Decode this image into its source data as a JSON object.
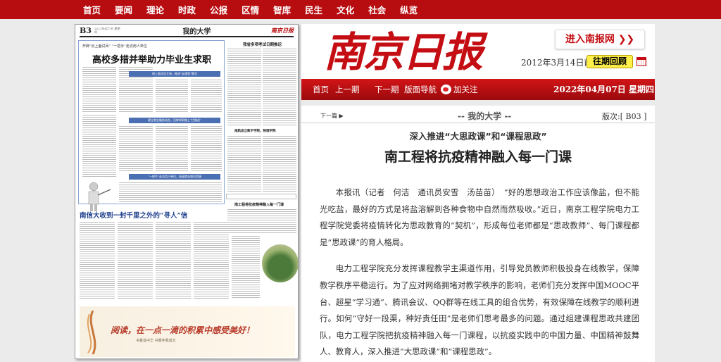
{
  "topnav": [
    "首页",
    "要闻",
    "理论",
    "时政",
    "公报",
    "区情",
    "智库",
    "民生",
    "文化",
    "社会",
    "纵览"
  ],
  "thumb": {
    "page": "B3",
    "date": "2022年4月7日 星期四",
    "section": "我的大学",
    "logo": "南京日报",
    "kicker": "开辟“云上面试间” “一把手”走访用人单位",
    "headline": "高校多措并举助力毕业生求职",
    "bar1": "线上面试没主场，推进“云课堂”教学",
    "bar2": "建立就业服务站台，扫除求职路上“拦路虎”",
    "bar3": "“一把手”走访用人单位，拓展就业岗位资源",
    "right_title1": "我省多项考试日期推迟",
    "right_title2": "南航成立数字学院，物理学院",
    "right_title3": "南工程将抗疫精神融入每一门课",
    "headline2": "南信大收到一封千里之外的“寻人”信",
    "ad_main": "阅读，在一点一滴的积累中感受美好！",
    "ad_sub": "书香溢中华 书香伴我成长"
  },
  "header": {
    "logo": "南京日报",
    "enter_label": "进入南报网 ❯❯",
    "old_date": "2012年3月14日前",
    "review_label": "往期回顾"
  },
  "rednav": {
    "home": "首页",
    "prev": "上一期",
    "next": "下一期",
    "guide": "版面导航",
    "follow": "加关注",
    "date": "2022年04月07日 星期四"
  },
  "article": {
    "next_article": "下一篇",
    "section": "-- 我的大学 --",
    "edition": "版次:[ B03 ]",
    "subtitle": "深入推进“大思政课”和“课程思政”",
    "title": "南工程将抗疫精神融入每一门课",
    "paragraphs": [
      "本报讯（记者　何洁　通讯员安雪　汤苗苗）　“好的思想政治工作应该像盐，但不能光吃盐，最好的方式是将盐溶解到各种食物中自然而然吸收。”近日，南京工程学院电力工程学院党委将疫情转化为思政教育的“契机”，形成每位老师都是“思政教师”、每门课程都是“思政课”的育人格局。",
      "电力工程学院充分发挥课程教学主渠道作用，引导党员教师积极投身在线教学，保障教学秩序平稳运行。为了应对网络拥堵对教学秩序的影响，老师们充分发挥中国MOOC平台、超星“学习通”、腾讯会议、QQ群等在线工具的组合优势，有效保障在线教学的顺利进行。如何“守好一段渠，种好责任田”是老师们思考最多的问题。通过组建课程思政共建团队，电力工程学院把抗疫精神融入每一门课程，以抗疫实践中的中国力量、中国精神鼓舞人、教育人，深入推进“大思政课”和“课程思政”。"
    ]
  }
}
